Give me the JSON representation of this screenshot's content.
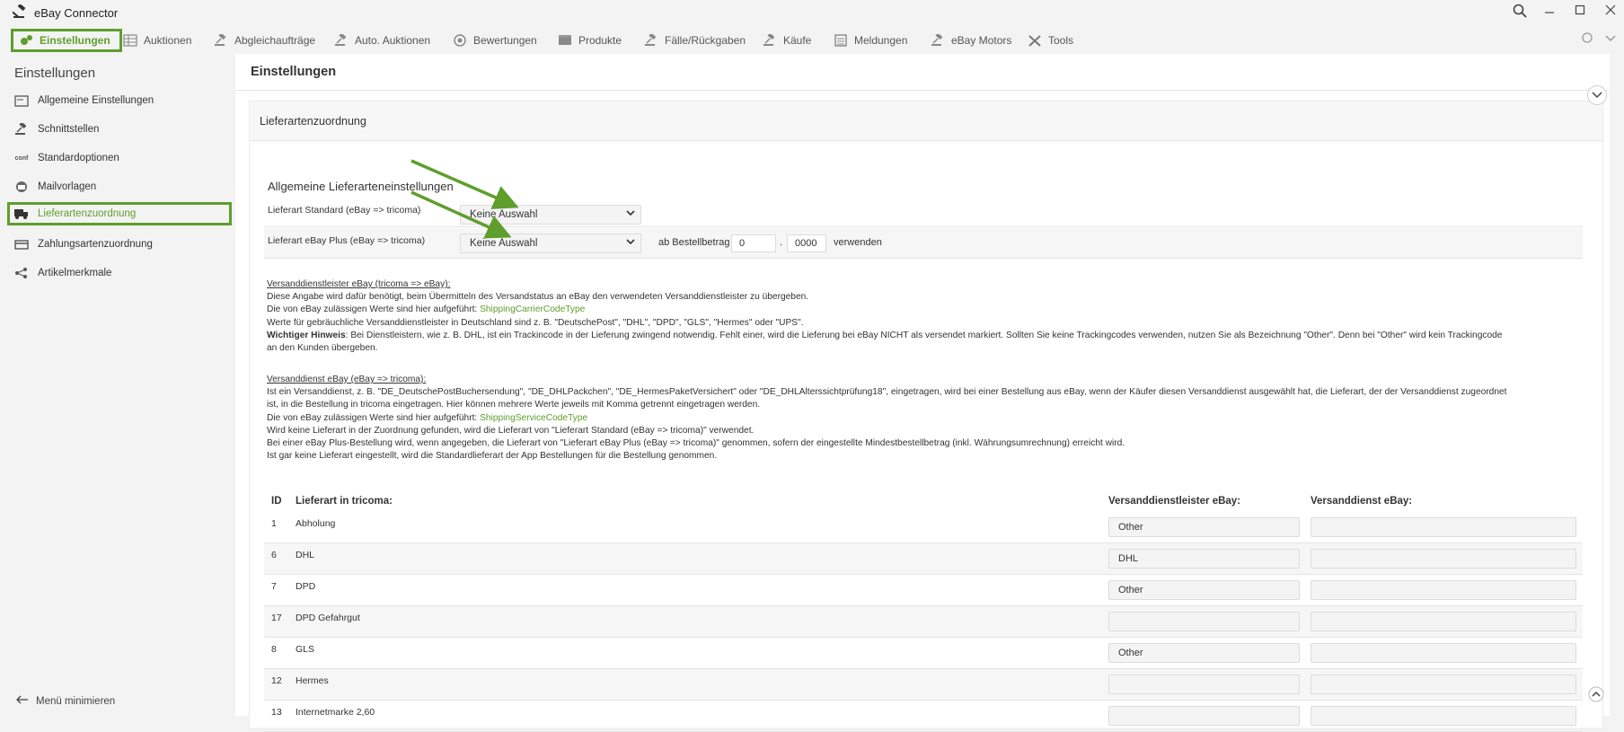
{
  "app": {
    "title": "eBay Connector"
  },
  "menu": [
    {
      "label": "Einstellungen",
      "icon": "gears-icon"
    },
    {
      "label": "Auktionen",
      "icon": "grid-icon"
    },
    {
      "label": "Abgleichaufträge",
      "icon": "gavel-icon"
    },
    {
      "label": "Auto. Auktionen",
      "icon": "gavel-icon"
    },
    {
      "label": "Bewertungen",
      "icon": "star-badge-icon"
    },
    {
      "label": "Produkte",
      "icon": "box-icon"
    },
    {
      "label": "Fälle/Rückgaben",
      "icon": "gavel-icon"
    },
    {
      "label": "Käufe",
      "icon": "gavel-icon"
    },
    {
      "label": "Meldungen",
      "icon": "list-icon"
    },
    {
      "label": "eBay Motors",
      "icon": "gavel-icon"
    },
    {
      "label": "Tools",
      "icon": "tools-icon"
    }
  ],
  "sidebar": {
    "title": "Einstellungen",
    "items": [
      {
        "label": "Allgemeine Einstellungen",
        "icon": "window-icon"
      },
      {
        "label": "Schnittstellen",
        "icon": "gavel-icon"
      },
      {
        "label": "Standardoptionen",
        "icon": "conf-icon"
      },
      {
        "label": "Mailvorlagen",
        "icon": "mail-icon"
      },
      {
        "label": "Lieferartenzuordnung",
        "icon": "truck-icon"
      },
      {
        "label": "Zahlungsartenzuordnung",
        "icon": "payment-icon"
      },
      {
        "label": "Artikelmerkmale",
        "icon": "nodes-icon"
      }
    ],
    "footer": "Menü minimieren"
  },
  "main": {
    "title": "Einstellungen",
    "panel_title": "Lieferartenzuordnung",
    "section_title": "Allgemeine Lieferarteneinstellungen",
    "standard_label": "Lieferart Standard (eBay => tricoma)",
    "standard_value": "Keine Auswahl",
    "plus_label": "Lieferart eBay Plus (eBay => tricoma)",
    "plus_value": "Keine Auswahl",
    "min_amount_label": "ab Bestellbetrag €",
    "min_amount_int": "0",
    "min_amount_sep": ".",
    "min_amount_dec": "0000",
    "use_label": "verwenden"
  },
  "info": {
    "carrier_heading": "Versanddienstleister eBay (tricoma => eBay):",
    "carrier_l1": "Diese Angabe wird dafür benötigt, beim Übermitteln des Versandstatus an eBay den verwendeten Versanddienstleister zu übergeben.",
    "carrier_l2_pre": "Die von eBay zulässigen Werte sind hier aufgeführt: ",
    "carrier_l2_link": "ShippingCarrierCodeType",
    "carrier_l3": "Werte für gebräuchliche Versanddienstleister in Deutschland sind z. B. \"DeutschePost\", \"DHL\", \"DPD\", \"GLS\", \"Hermes\" oder \"UPS\".",
    "carrier_l4_bold": "Wichtiger Hinweis",
    "carrier_l4": ": Bei Dienstleistern, wie z. B. DHL, ist ein Trackincode in der Lieferung zwingend notwendig. Fehlt einer, wird die Lieferung bei eBay NICHT als versendet markiert. Sollten Sie keine Trackingcodes verwenden, nutzen Sie als Bezeichnung \"Other\". Denn bei \"Other\" wird kein Trackingcode",
    "carrier_l5": "an den Kunden übergeben.",
    "service_heading": "Versanddienst eBay (eBay => tricoma):",
    "service_l1": "Ist ein Versanddienst, z. B. \"DE_DeutschePostBuchersendung\", \"DE_DHLPackchen\", \"DE_HermesPaketVersichert\" oder \"DE_DHLAlterssichtprüfung18\", eingetragen, wird bei einer Bestellung aus eBay, wenn der Käufer diesen Versanddienst ausgewählt hat, die Lieferart, der der Versanddienst zugeordnet",
    "service_l2": "ist, in die Bestellung in tricoma eingetragen. Hier können mehrere Werte jeweils mit Komma getrennt eingetragen werden.",
    "service_l3_pre": "Die von eBay zulässigen Werte sind hier aufgeführt: ",
    "service_l3_link": "ShippingServiceCodeType",
    "service_l4": "Wird keine Lieferart in der Zuordnung gefunden, wird die Lieferart von \"Lieferart Standard (eBay => tricoma)\" verwendet.",
    "service_l5": "Bei einer eBay Plus-Bestellung wird, wenn angegeben, die Lieferart von \"Lieferart eBay Plus (eBay => tricoma)\" genommen, sofern der eingestellte Mindestbestellbetrag (inkl. Währungsumrechnung) erreicht wird.",
    "service_l6": "Ist gar keine Lieferart eingestellt, wird die Standardlieferart der App Bestellungen für die Bestellung genommen."
  },
  "table": {
    "headers": {
      "id": "ID",
      "name": "Lieferart in tricoma:",
      "carrier": "Versanddienstleister eBay:",
      "service": "Versanddienst eBay:"
    },
    "rows": [
      {
        "id": "1",
        "name": "Abholung",
        "carrier": "Other",
        "service": ""
      },
      {
        "id": "6",
        "name": "DHL",
        "carrier": "DHL",
        "service": ""
      },
      {
        "id": "7",
        "name": "DPD",
        "carrier": "Other",
        "service": ""
      },
      {
        "id": "17",
        "name": "DPD Gefahrgut",
        "carrier": "",
        "service": ""
      },
      {
        "id": "8",
        "name": "GLS",
        "carrier": "Other",
        "service": ""
      },
      {
        "id": "12",
        "name": "Hermes",
        "carrier": "",
        "service": ""
      },
      {
        "id": "13",
        "name": "Internetmarke 2,60",
        "carrier": "",
        "service": ""
      }
    ]
  },
  "colors": {
    "accent": "#5f9e2d",
    "arrow": "#5f9e2d"
  }
}
